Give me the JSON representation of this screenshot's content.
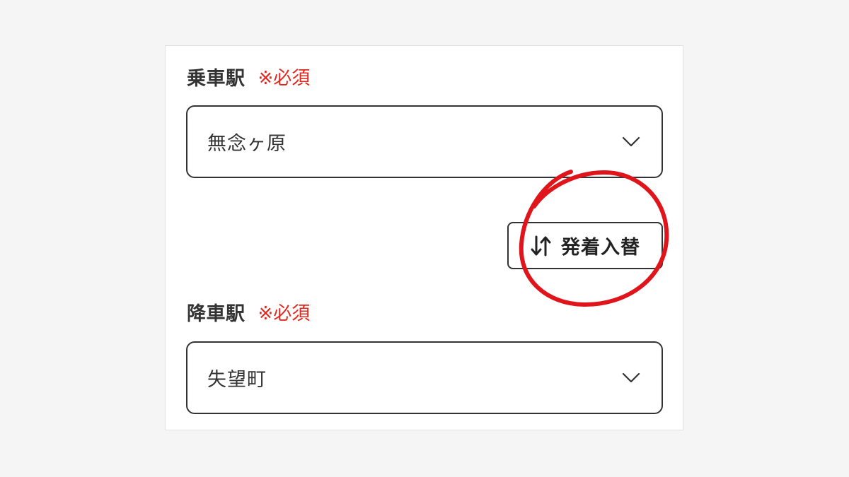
{
  "departure": {
    "label": "乗車駅",
    "required": "※必須",
    "value": "無念ヶ原"
  },
  "swap": {
    "label": "発着入替"
  },
  "arrival": {
    "label": "降車駅",
    "required": "※必須",
    "value": "失望町"
  },
  "colors": {
    "required": "#e0281e",
    "annotation": "#e0151b",
    "border": "#333333"
  },
  "icons": {
    "dropdown": "chevron-down-icon",
    "swap": "swap-arrows-icon"
  }
}
